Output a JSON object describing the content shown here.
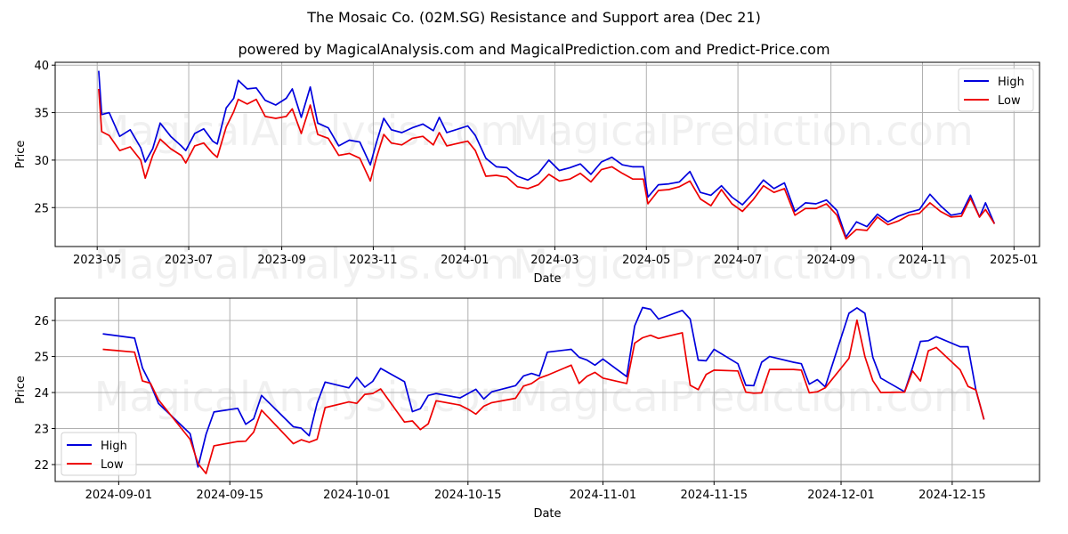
{
  "title": "The Mosaic Co. (02M.SG) Resistance and Support area (Dec 21)",
  "subtitle": "powered by MagicalAnalysis.com and MagicalPrediction.com and Predict-Price.com",
  "watermarks": [
    "MagicalAnalysis.com",
    "MagicalPrediction.com"
  ],
  "colors": {
    "high": "#0000dd",
    "low": "#ee0000",
    "grid": "#b0b0b0"
  },
  "chart_data": [
    {
      "type": "line",
      "title": "",
      "xlabel": "Date",
      "ylabel": "Price",
      "ylim": [
        20.9,
        40.3
      ],
      "xlim": [
        "2023-04-03",
        "2025-01-18"
      ],
      "yticks": [
        25,
        30,
        35,
        40
      ],
      "xticks": [
        "2023-05",
        "2023-07",
        "2023-09",
        "2023-11",
        "2024-01",
        "2024-03",
        "2024-05",
        "2024-07",
        "2024-09",
        "2024-11",
        "2025-01"
      ],
      "xtick_dates": [
        "2023-05-01",
        "2023-07-01",
        "2023-09-01",
        "2023-11-01",
        "2024-01-01",
        "2024-03-01",
        "2024-05-01",
        "2024-07-01",
        "2024-09-01",
        "2024-11-01",
        "2025-01-01"
      ],
      "grid": true,
      "legend": "top-right",
      "x": [
        "2023-05-02",
        "2023-05-04",
        "2023-05-09",
        "2023-05-16",
        "2023-05-23",
        "2023-05-30",
        "2023-06-02",
        "2023-06-07",
        "2023-06-12",
        "2023-06-19",
        "2023-06-26",
        "2023-06-29",
        "2023-07-05",
        "2023-07-11",
        "2023-07-17",
        "2023-07-20",
        "2023-07-26",
        "2023-07-31",
        "2023-08-03",
        "2023-08-09",
        "2023-08-15",
        "2023-08-21",
        "2023-08-28",
        "2023-09-04",
        "2023-09-08",
        "2023-09-14",
        "2023-09-20",
        "2023-09-25",
        "2023-10-02",
        "2023-10-09",
        "2023-10-16",
        "2023-10-23",
        "2023-10-30",
        "2023-11-03",
        "2023-11-08",
        "2023-11-13",
        "2023-11-20",
        "2023-11-27",
        "2023-12-04",
        "2023-12-11",
        "2023-12-15",
        "2023-12-20",
        "2024-01-03",
        "2024-01-08",
        "2024-01-15",
        "2024-01-22",
        "2024-01-29",
        "2024-02-05",
        "2024-02-12",
        "2024-02-19",
        "2024-02-26",
        "2024-03-04",
        "2024-03-11",
        "2024-03-18",
        "2024-03-25",
        "2024-04-01",
        "2024-04-08",
        "2024-04-15",
        "2024-04-22",
        "2024-04-29",
        "2024-05-02",
        "2024-05-09",
        "2024-05-16",
        "2024-05-23",
        "2024-05-30",
        "2024-06-06",
        "2024-06-13",
        "2024-06-20",
        "2024-06-27",
        "2024-07-04",
        "2024-07-11",
        "2024-07-18",
        "2024-07-25",
        "2024-08-01",
        "2024-08-08",
        "2024-08-15",
        "2024-08-22",
        "2024-08-29",
        "2024-09-05",
        "2024-09-11",
        "2024-09-18",
        "2024-09-25",
        "2024-10-02",
        "2024-10-09",
        "2024-10-16",
        "2024-10-23",
        "2024-10-30",
        "2024-11-06",
        "2024-11-13",
        "2024-11-20",
        "2024-11-27",
        "2024-12-03",
        "2024-12-09",
        "2024-12-13",
        "2024-12-19"
      ],
      "series": [
        {
          "name": "High",
          "values": [
            39.4,
            34.8,
            35.0,
            32.5,
            33.2,
            31.3,
            29.8,
            31.2,
            33.9,
            32.5,
            31.5,
            31.0,
            32.8,
            33.3,
            32.0,
            31.7,
            35.5,
            36.5,
            38.4,
            37.5,
            37.6,
            36.3,
            35.8,
            36.5,
            37.5,
            34.5,
            37.7,
            33.9,
            33.4,
            31.5,
            32.1,
            31.9,
            29.5,
            31.8,
            34.4,
            33.2,
            32.9,
            33.4,
            33.8,
            33.1,
            34.5,
            32.9,
            33.6,
            32.6,
            30.2,
            29.3,
            29.2,
            28.3,
            27.9,
            28.6,
            30.0,
            28.9,
            29.2,
            29.6,
            28.5,
            29.8,
            30.3,
            29.5,
            29.3,
            29.3,
            26.1,
            27.4,
            27.5,
            27.7,
            28.8,
            26.6,
            26.3,
            27.3,
            26.1,
            25.3,
            26.5,
            27.9,
            27.0,
            27.6,
            24.6,
            25.5,
            25.4,
            25.8,
            24.7,
            21.9,
            23.5,
            23.0,
            24.3,
            23.5,
            24.1,
            24.5,
            24.8,
            26.4,
            25.2,
            24.2,
            24.4,
            26.3,
            24.0,
            25.5,
            23.3
          ]
        },
        {
          "name": "Low",
          "values": [
            37.5,
            33.0,
            32.6,
            31.0,
            31.4,
            30.0,
            28.1,
            30.5,
            32.2,
            31.2,
            30.5,
            29.7,
            31.5,
            31.8,
            30.7,
            30.3,
            33.5,
            35.1,
            36.4,
            35.9,
            36.4,
            34.6,
            34.4,
            34.6,
            35.4,
            32.8,
            35.8,
            32.7,
            32.3,
            30.5,
            30.7,
            30.2,
            27.8,
            30.2,
            32.7,
            31.8,
            31.6,
            32.3,
            32.5,
            31.6,
            32.9,
            31.5,
            32.0,
            31.0,
            28.3,
            28.4,
            28.2,
            27.2,
            27.0,
            27.4,
            28.5,
            27.8,
            28.0,
            28.6,
            27.7,
            29.0,
            29.3,
            28.6,
            28.0,
            28.0,
            25.4,
            26.8,
            26.9,
            27.2,
            27.8,
            25.9,
            25.2,
            26.9,
            25.4,
            24.6,
            25.8,
            27.3,
            26.6,
            27.0,
            24.2,
            24.9,
            24.9,
            25.4,
            24.2,
            21.7,
            22.7,
            22.6,
            24.0,
            23.2,
            23.6,
            24.2,
            24.4,
            25.5,
            24.6,
            24.0,
            24.1,
            26.0,
            24.0,
            24.8,
            23.3
          ]
        }
      ]
    },
    {
      "type": "line",
      "title": "",
      "xlabel": "Date",
      "ylabel": "Price",
      "ylim": [
        21.53,
        26.62
      ],
      "xlim": [
        "2024-08-24",
        "2024-12-26"
      ],
      "yticks": [
        22,
        23,
        24,
        25,
        26
      ],
      "xticks": [
        "2024-09-01",
        "2024-09-15",
        "2024-10-01",
        "2024-10-15",
        "2024-11-01",
        "2024-11-15",
        "2024-12-01",
        "2024-12-15"
      ],
      "grid": true,
      "legend": "lower-left",
      "x": [
        "2024-08-30",
        "2024-09-03",
        "2024-09-04",
        "2024-09-05",
        "2024-09-06",
        "2024-09-10",
        "2024-09-11",
        "2024-09-12",
        "2024-09-13",
        "2024-09-16",
        "2024-09-17",
        "2024-09-18",
        "2024-09-19",
        "2024-09-23",
        "2024-09-24",
        "2024-09-25",
        "2024-09-26",
        "2024-09-27",
        "2024-09-30",
        "2024-10-01",
        "2024-10-02",
        "2024-10-03",
        "2024-10-04",
        "2024-10-07",
        "2024-10-08",
        "2024-10-09",
        "2024-10-10",
        "2024-10-11",
        "2024-10-14",
        "2024-10-15",
        "2024-10-16",
        "2024-10-17",
        "2024-10-18",
        "2024-10-21",
        "2024-10-22",
        "2024-10-23",
        "2024-10-24",
        "2024-10-25",
        "2024-10-28",
        "2024-10-29",
        "2024-10-30",
        "2024-10-31",
        "2024-11-01",
        "2024-11-04",
        "2024-11-05",
        "2024-11-06",
        "2024-11-07",
        "2024-11-08",
        "2024-11-11",
        "2024-11-12",
        "2024-11-13",
        "2024-11-14",
        "2024-11-15",
        "2024-11-18",
        "2024-11-19",
        "2024-11-20",
        "2024-11-21",
        "2024-11-22",
        "2024-11-25",
        "2024-11-26",
        "2024-11-27",
        "2024-11-28",
        "2024-11-29",
        "2024-12-02",
        "2024-12-03",
        "2024-12-04",
        "2024-12-05",
        "2024-12-06",
        "2024-12-09",
        "2024-12-10",
        "2024-12-11",
        "2024-12-12",
        "2024-12-13",
        "2024-12-16",
        "2024-12-17",
        "2024-12-18",
        "2024-12-19"
      ],
      "series": [
        {
          "name": "High",
          "values": [
            25.63,
            25.51,
            24.68,
            24.24,
            23.7,
            22.86,
            21.93,
            22.84,
            23.46,
            23.56,
            23.12,
            23.27,
            23.92,
            23.05,
            23.01,
            22.8,
            23.7,
            24.29,
            24.13,
            24.42,
            24.15,
            24.31,
            24.67,
            24.3,
            23.47,
            23.55,
            23.92,
            23.97,
            23.85,
            23.97,
            24.09,
            23.82,
            24.02,
            24.19,
            24.46,
            24.53,
            24.46,
            25.12,
            25.2,
            24.98,
            24.9,
            24.76,
            24.93,
            24.44,
            25.85,
            26.36,
            26.31,
            26.04,
            26.28,
            26.04,
            24.9,
            24.88,
            25.2,
            24.8,
            24.2,
            24.19,
            24.84,
            25.0,
            24.84,
            24.8,
            24.23,
            24.36,
            24.16,
            26.2,
            26.35,
            26.2,
            24.98,
            24.4,
            24.02,
            24.69,
            25.42,
            25.44,
            25.55,
            25.27,
            25.27,
            24.06,
            23.25
          ]
        },
        {
          "name": "Low",
          "values": [
            25.2,
            25.12,
            24.32,
            24.26,
            23.8,
            22.7,
            22.03,
            21.75,
            22.52,
            22.64,
            22.65,
            22.9,
            23.51,
            22.58,
            22.69,
            22.62,
            22.7,
            23.58,
            23.74,
            23.7,
            23.95,
            23.97,
            24.1,
            23.18,
            23.21,
            22.97,
            23.13,
            23.77,
            23.65,
            23.54,
            23.4,
            23.62,
            23.72,
            23.84,
            24.18,
            24.25,
            24.4,
            24.48,
            24.76,
            24.25,
            24.45,
            24.56,
            24.4,
            24.25,
            25.37,
            25.52,
            25.59,
            25.5,
            25.66,
            24.2,
            24.08,
            24.5,
            24.62,
            24.6,
            24.01,
            23.98,
            23.99,
            24.64,
            24.64,
            24.62,
            23.99,
            24.02,
            24.13,
            24.95,
            26.01,
            25.0,
            24.33,
            24.0,
            24.01,
            24.6,
            24.32,
            25.16,
            25.25,
            24.63,
            24.17,
            24.07,
            23.25
          ]
        }
      ]
    }
  ]
}
